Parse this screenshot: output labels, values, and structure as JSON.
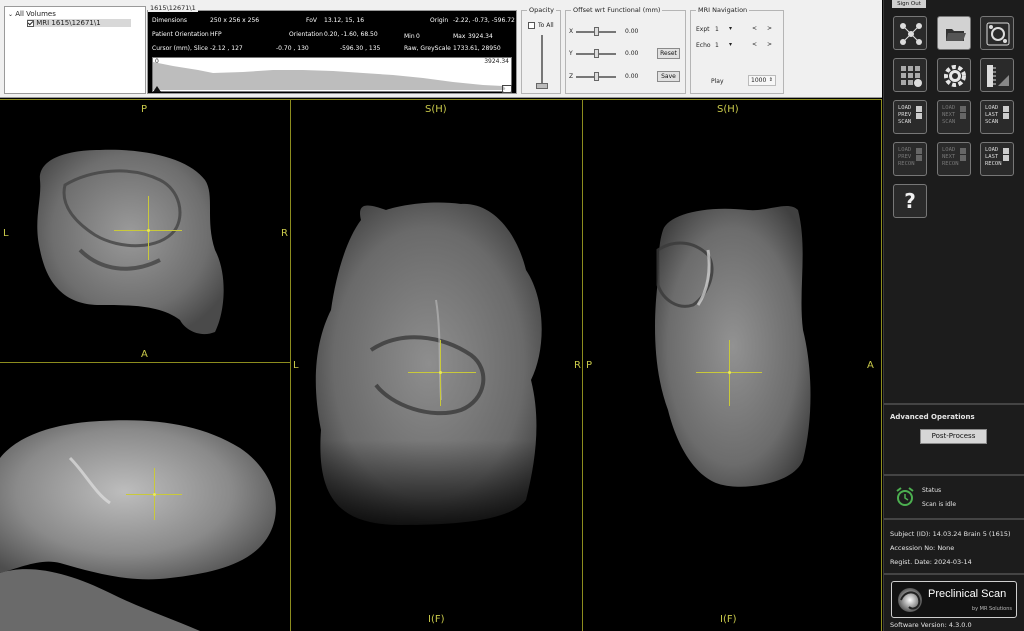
{
  "tree": {
    "root": "All Volumes",
    "item": "MRI 1615\\12671\\1"
  },
  "info": {
    "legend": "1615\\12671\\1",
    "dimensions_label": "Dimensions",
    "dimensions": "250 x 256 x 256",
    "fov_label": "FoV",
    "fov": "13.12, 15, 16",
    "origin_label": "Origin",
    "origin": "-2.22, -0.73, -596.72",
    "patient_orientation_label": "Patient Orientation",
    "patient_orientation": "HFP",
    "orientation_label": "Orientation",
    "orientation": "0.20, -1.60, 68.50",
    "min_label": "Min",
    "min": "0",
    "max_label": "Max",
    "max": "3924.34",
    "cursor_label": "Cursor (mm), Slice",
    "cursor_a": "-2.12 , 127",
    "cursor_b": "-0.70 , 130",
    "cursor_c": "-596.30 , 135",
    "raw_label": "Raw, GreyScale",
    "raw": "1733.61, 28950",
    "hist_min": "0",
    "hist_max": "3924.34"
  },
  "opacity": {
    "legend": "Opacity",
    "to_all": "To All",
    "value": 0.0
  },
  "offset": {
    "legend": "Offset wrt Functional (mm)",
    "x_label": "X",
    "x": "0.00",
    "y_label": "Y",
    "y": "0.00",
    "z_label": "Z",
    "z": "0.00",
    "reset": "Reset",
    "save": "Save"
  },
  "nav": {
    "legend": "MRI Navigation",
    "expt_label": "Expt",
    "expt": "1",
    "echo_label": "Echo",
    "echo": "1",
    "play": "Play",
    "speed": "1000"
  },
  "views": {
    "axial": {
      "top": "P",
      "bottom": "A",
      "left": "L",
      "right": "R"
    },
    "coronal": {
      "top": "S(H)",
      "bottom": "I(F)",
      "left": "L",
      "right": "R"
    },
    "sagittal": {
      "top": "S(H)",
      "bottom": "I(F)",
      "left": "P",
      "right": "A"
    }
  },
  "sidebar": {
    "signout": "Sign Out",
    "load_prev_scan": [
      "LOAD",
      "PREV",
      "SCAN"
    ],
    "load_next_scan": [
      "LOAD",
      "NEXT",
      "SCAN"
    ],
    "load_last_scan": [
      "LOAD",
      "LAST",
      "SCAN"
    ],
    "load_prev_recon": [
      "LOAD",
      "PREV",
      "RECON"
    ],
    "load_next_recon": [
      "LOAD",
      "NEXT",
      "RECON"
    ],
    "load_last_recon": [
      "LOAD",
      "LAST",
      "RECON"
    ],
    "help": "?",
    "advanced_title": "Advanced Operations",
    "post_process": "Post-Process",
    "status_label": "Status",
    "status_value": "Scan is idle",
    "subject": "Subject (ID):  14.03.24 Brain 5 (1615)",
    "accession": "Accession No: None",
    "regist": "Regist. Date:  2024-03-14",
    "brand": "Preclinical Scan",
    "brand_sub": "by MR Solutions",
    "version": "Software Version:  4.3.0.0"
  }
}
